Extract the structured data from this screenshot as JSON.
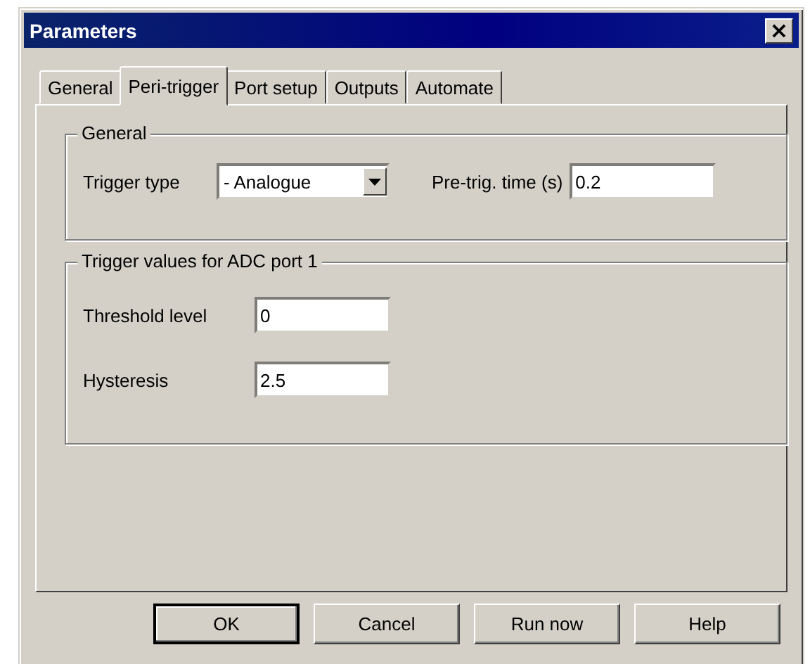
{
  "window": {
    "title": "Parameters",
    "close": "×"
  },
  "tabs": [
    {
      "label": "General",
      "selected": false
    },
    {
      "label": "Peri-trigger",
      "selected": true
    },
    {
      "label": "Port setup",
      "selected": false
    },
    {
      "label": "Outputs",
      "selected": false
    },
    {
      "label": "Automate",
      "selected": false
    }
  ],
  "groups": [
    {
      "title": "General",
      "fields": [
        {
          "kind": "dropdown",
          "label": "Trigger type",
          "value": "- Analogue"
        },
        {
          "kind": "text",
          "label": "Pre-trig. time (s)",
          "value": "0.2"
        }
      ]
    },
    {
      "title": "Trigger values for ADC port 1",
      "fields": [
        {
          "kind": "text",
          "label": "Threshold level",
          "value": "0"
        },
        {
          "kind": "text",
          "label": "Hysteresis",
          "value": "2.5"
        }
      ]
    }
  ],
  "buttons": [
    {
      "label": "OK",
      "default": true
    },
    {
      "label": "Cancel",
      "default": false
    },
    {
      "label": "Run now",
      "default": false
    },
    {
      "label": "Help",
      "default": false
    }
  ]
}
